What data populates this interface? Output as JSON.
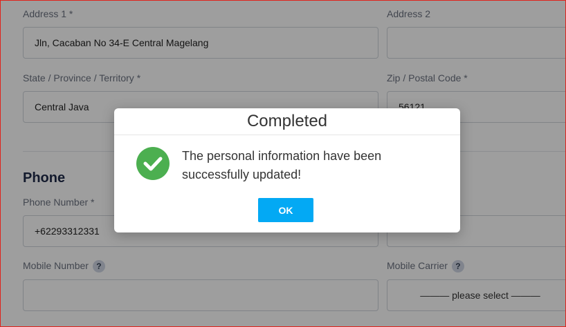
{
  "form": {
    "address1": {
      "label": "Address 1 *",
      "value": "Jln, Cacaban No 34-E Central Magelang"
    },
    "address2": {
      "label": "Address 2",
      "value": ""
    },
    "state": {
      "label": "State / Province / Territory *",
      "value": "Central Java"
    },
    "zip": {
      "label": "Zip / Postal Code *",
      "value": "56121"
    },
    "phone_section_title": "Phone",
    "phone_number": {
      "label": "Phone Number *",
      "value": "+62293312331"
    },
    "mobile_number": {
      "label": "Mobile Number",
      "help": "?",
      "value": ""
    },
    "mobile_carrier": {
      "label": "Mobile Carrier",
      "help": "?",
      "selected": "——— please select ———"
    }
  },
  "dialog": {
    "title": "Completed",
    "icon": "check-circle-icon",
    "message": "The personal information have been successfully updated!",
    "ok_label": "OK",
    "icon_color": "#4caf50",
    "button_color": "#03a9f4"
  },
  "colors": {
    "page_border": "#e0211a",
    "overlay": "rgba(0,0,0,0.38)"
  }
}
